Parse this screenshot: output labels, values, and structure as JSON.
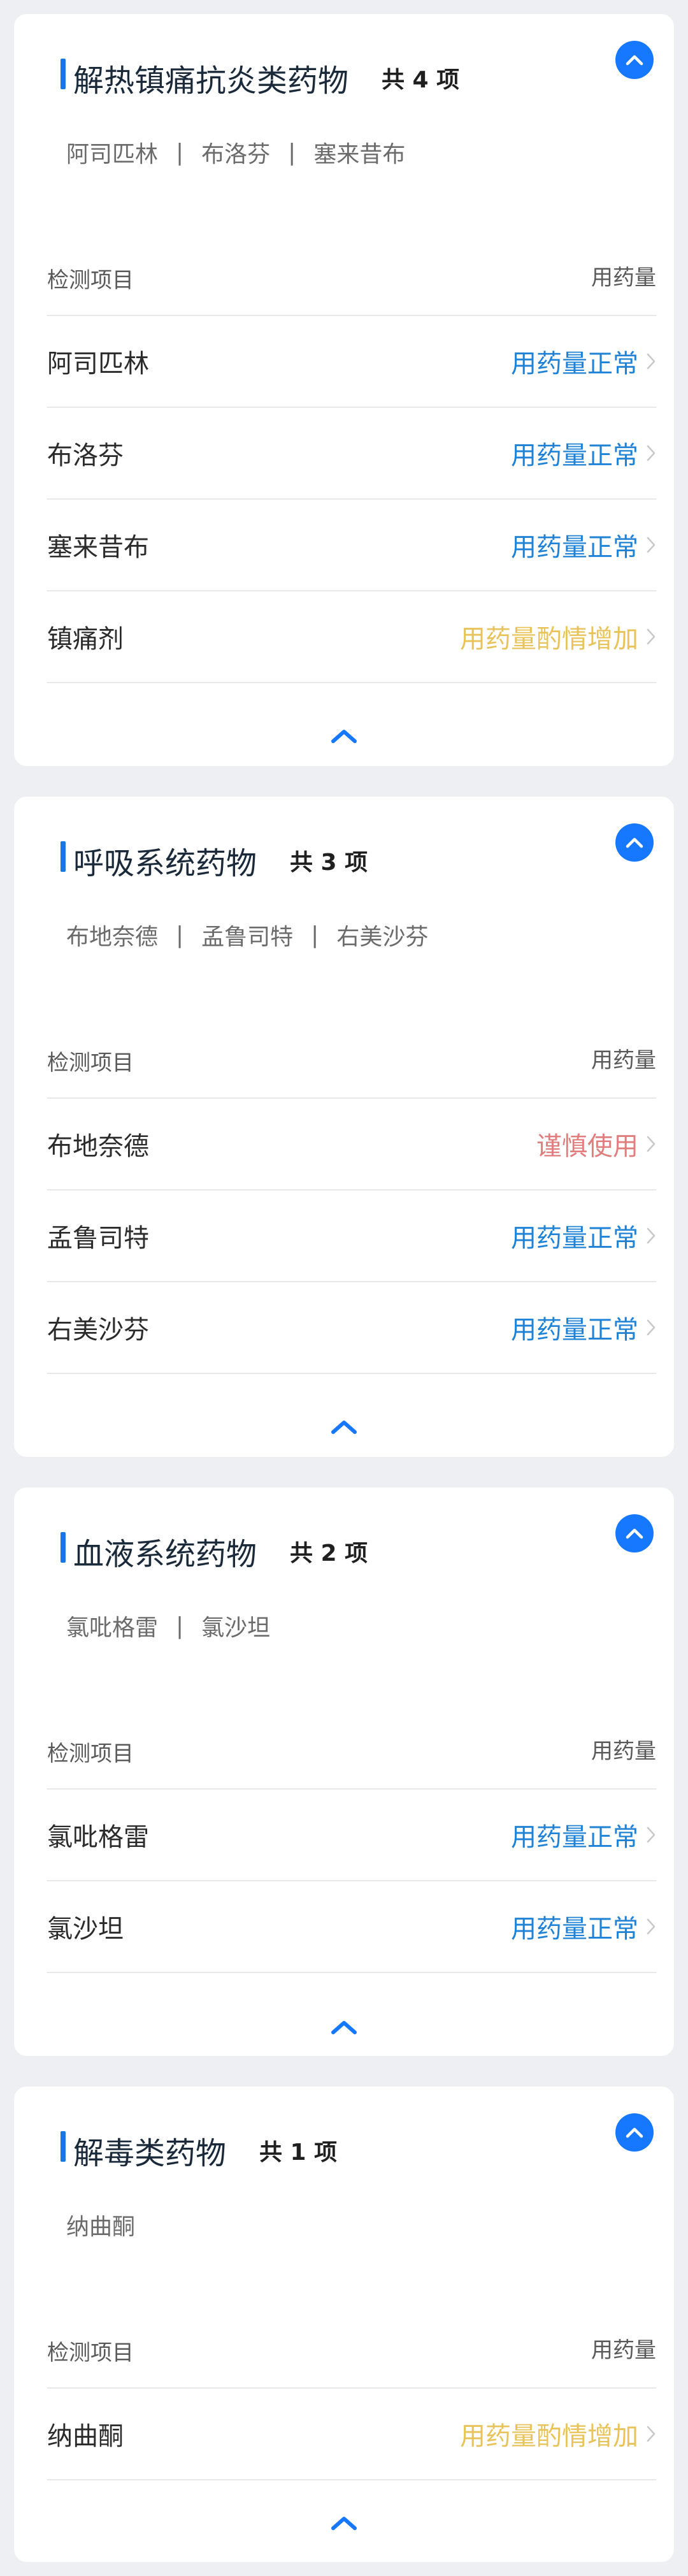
{
  "colors": {
    "accent": "#1677ff",
    "normal": "#1e82d6",
    "increase": "#e8c35a",
    "caution": "#e07e7e",
    "page_background": "#eeeff3"
  },
  "table_header": {
    "item": "检测项目",
    "dosage": "用药量"
  },
  "sections": [
    {
      "title": "解热镇痛抗炎类药物",
      "count": "共 4 项",
      "summary": [
        "阿司匹林",
        "布洛芬",
        "塞来昔布"
      ],
      "rows": [
        {
          "name": "阿司匹林",
          "status": "用药量正常",
          "level": "normal"
        },
        {
          "name": "布洛芬",
          "status": "用药量正常",
          "level": "normal"
        },
        {
          "name": "塞来昔布",
          "status": "用药量正常",
          "level": "normal"
        },
        {
          "name": "镇痛剂",
          "status": "用药量酌情增加",
          "level": "increase"
        }
      ]
    },
    {
      "title": "呼吸系统药物",
      "count": "共 3 项",
      "summary": [
        "布地奈德",
        "孟鲁司特",
        "右美沙芬"
      ],
      "rows": [
        {
          "name": "布地奈德",
          "status": "谨慎使用",
          "level": "caution"
        },
        {
          "name": "孟鲁司特",
          "status": "用药量正常",
          "level": "normal"
        },
        {
          "name": "右美沙芬",
          "status": "用药量正常",
          "level": "normal"
        }
      ]
    },
    {
      "title": "血液系统药物",
      "count": "共 2 项",
      "summary": [
        "氯吡格雷",
        "氯沙坦"
      ],
      "rows": [
        {
          "name": "氯吡格雷",
          "status": "用药量正常",
          "level": "normal"
        },
        {
          "name": "氯沙坦",
          "status": "用药量正常",
          "level": "normal"
        }
      ]
    },
    {
      "title": "解毒类药物",
      "count": "共 1 项",
      "summary": [
        "纳曲酮"
      ],
      "rows": [
        {
          "name": "纳曲酮",
          "status": "用药量酌情增加",
          "level": "increase"
        }
      ]
    }
  ],
  "icons": {
    "collapse": "chevron-up-icon",
    "row_arrow": "chevron-right-icon",
    "footer": "chevron-up-icon"
  }
}
